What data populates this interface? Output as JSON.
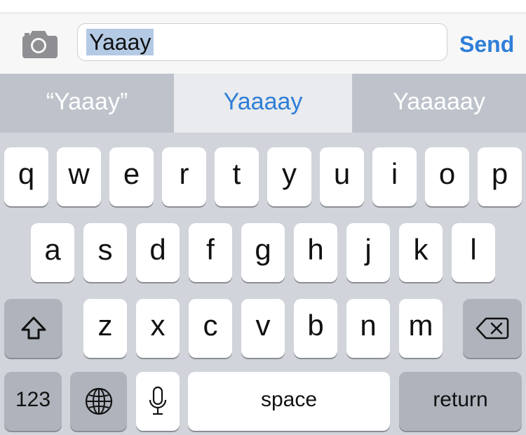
{
  "input": {
    "text": "Yaaay",
    "send_label": "Send",
    "camera_icon": "camera-icon"
  },
  "suggestions": [
    "“Yaaay”",
    "Yaaaay",
    "Yaaaaay"
  ],
  "rows": {
    "row1": [
      "q",
      "w",
      "e",
      "r",
      "t",
      "y",
      "u",
      "i",
      "o",
      "p"
    ],
    "row2": [
      "a",
      "s",
      "d",
      "f",
      "g",
      "h",
      "j",
      "k",
      "l"
    ],
    "row3": [
      "z",
      "x",
      "c",
      "v",
      "b",
      "n",
      "m"
    ]
  },
  "bottom": {
    "numbers": "123",
    "space": "space",
    "return": "return"
  },
  "icons": {
    "shift": "shift-icon",
    "backspace": "backspace-icon",
    "globe": "globe-icon",
    "mic": "microphone-icon"
  },
  "colors": {
    "accent": "#2f7ed8",
    "selection": "#b4cae4",
    "keyboard_bg": "#d1d4da",
    "dark_key": "#aeb3bc"
  }
}
